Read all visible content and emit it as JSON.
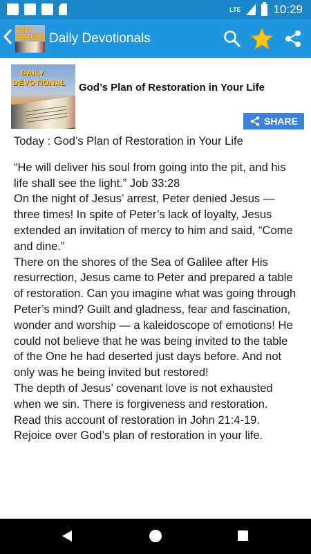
{
  "status_bar": {
    "network": "LTE",
    "time": "10:29"
  },
  "app_bar": {
    "logo_text_line1": "DAILY",
    "logo_text_line2": "DEVOTIONAL",
    "title": "Daily Devotionals",
    "icons": [
      "back-arrow-icon",
      "search-icon",
      "star-icon",
      "share-icon"
    ],
    "accent_color": "#2196e0",
    "star_color": "#f5c518"
  },
  "post": {
    "thumbnail_text_line1": "DAILY",
    "thumbnail_text_line2": "DEVOTIONAL",
    "title": "God’s Plan of Restoration in Your Life",
    "share_label": "SHARE",
    "share_color": "#3b82d8"
  },
  "article": {
    "heading": "Today : God’s Plan of Restoration in Your Life",
    "paragraphs": [
      "“He will deliver his soul from going into the pit, and his life shall see the light.” Job 33:28",
      "On the night of Jesus’ arrest, Peter denied Jesus — three times! In spite of Peter’s lack of loyalty, Jesus extended an invitation of mercy to him and said, “Come and dine.”",
      "There on the shores of the Sea of Galilee after His resurrection, Jesus came to Peter and prepared a table of restoration. Can you imagine what was going through Peter’s mind? Guilt and gladness, fear and fascination, wonder and worship — a kaleidoscope of emotions! He could not believe that he was being invited to the table of the One he had deserted just days before. And not only was he being invited but restored!",
      "The depth of Jesus’ covenant love is not exhausted when we sin. There is forgiveness and restoration. Read this account of restoration in John 21:4-19. Rejoice over God’s plan of restoration in your life."
    ]
  },
  "nav_bar": {
    "icons": [
      "nav-back-icon",
      "nav-home-icon",
      "nav-recents-icon"
    ]
  }
}
